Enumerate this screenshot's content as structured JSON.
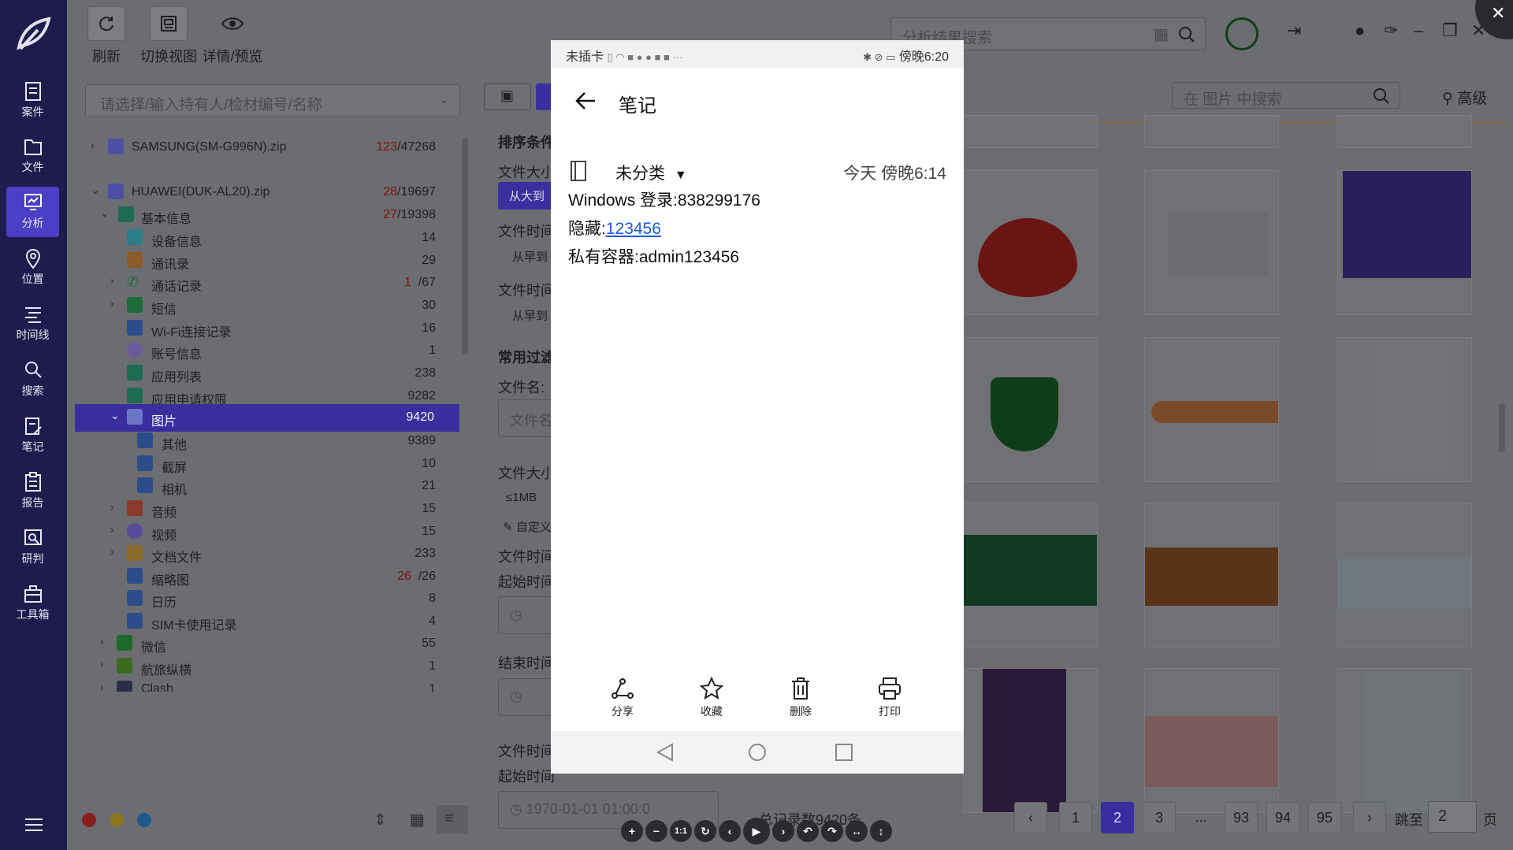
{
  "nav": {
    "items": [
      {
        "label": "案件",
        "icon": "case-icon"
      },
      {
        "label": "文件",
        "icon": "folder-icon"
      },
      {
        "label": "分析",
        "icon": "analysis-icon"
      },
      {
        "label": "位置",
        "icon": "location-icon"
      },
      {
        "label": "时间线",
        "icon": "timeline-icon"
      },
      {
        "label": "搜索",
        "icon": "search-icon"
      },
      {
        "label": "笔记",
        "icon": "note-icon"
      },
      {
        "label": "报告",
        "icon": "report-icon"
      },
      {
        "label": "研判",
        "icon": "judge-icon"
      },
      {
        "label": "工具箱",
        "icon": "toolbox-icon"
      }
    ],
    "active": "分析"
  },
  "toolbar": {
    "refresh": "刷新",
    "switch_view": "切换视图",
    "details": "详情/预览"
  },
  "left_panel": {
    "selector_placeholder": "请选择/输入持有人/检材编号/名称",
    "tree": [
      {
        "label": "SAMSUNG(SM-G996N).zip",
        "red": "123",
        "count": "/47268"
      },
      {
        "label": "HUAWEI(DUK-AL20).zip",
        "red": "28",
        "count": "/19697"
      },
      {
        "label": "基本信息",
        "red": "27",
        "count": "/19398"
      },
      {
        "label": "设备信息",
        "red": "",
        "count": "14"
      },
      {
        "label": "通讯录",
        "red": "",
        "count": "29"
      },
      {
        "label": "通话记录",
        "red": "1",
        "count": "/67"
      },
      {
        "label": "短信",
        "red": "",
        "count": "30"
      },
      {
        "label": "Wi-Fi连接记录",
        "red": "",
        "count": "16"
      },
      {
        "label": "账号信息",
        "red": "",
        "count": "1"
      },
      {
        "label": "应用列表",
        "red": "",
        "count": "238"
      },
      {
        "label": "应用申请权限",
        "red": "",
        "count": "9282"
      },
      {
        "label": "图片",
        "red": "",
        "count": "9420"
      },
      {
        "label": "其他",
        "red": "",
        "count": "9389"
      },
      {
        "label": "截屏",
        "red": "",
        "count": "10"
      },
      {
        "label": "相机",
        "red": "",
        "count": "21"
      },
      {
        "label": "音频",
        "red": "",
        "count": "15"
      },
      {
        "label": "视频",
        "red": "",
        "count": "15"
      },
      {
        "label": "文档文件",
        "red": "",
        "count": "233"
      },
      {
        "label": "缩略图",
        "red": "26",
        "count": "/26"
      },
      {
        "label": "日历",
        "red": "",
        "count": "8"
      },
      {
        "label": "SIM卡使用记录",
        "red": "",
        "count": "4"
      },
      {
        "label": "微信",
        "red": "",
        "count": "55"
      },
      {
        "label": "航旅纵横",
        "red": "",
        "count": "1"
      },
      {
        "label": "Clash",
        "red": "",
        "count": "1"
      }
    ]
  },
  "filter": {
    "sort_title": "排序条件",
    "file_size": "文件大小",
    "size_btn": "从大到",
    "file_time1": "文件时间",
    "from_early1": "从早到",
    "file_time2": "文件时间",
    "from_early2": "从早到",
    "common_filter": "常用过滤",
    "file_name": "文件名:",
    "file_name_ph": "文件名",
    "file_size2": "文件大小",
    "le1mb": "≤1MB",
    "custom": "自定义",
    "file_time3": "文件时间",
    "start_time": "起始时间",
    "end_time": "结束时间",
    "file_time4": "文件时间",
    "start_time2": "起始时间",
    "date_value": "1970-01-01 01:00:0"
  },
  "top": {
    "search_placeholder": "分析结果搜索",
    "img_search_placeholder": "在 图片 中搜索",
    "advanced": "高级"
  },
  "pagination": {
    "total": "总记录数9420条",
    "pages": [
      "1",
      "2",
      "3",
      "...",
      "93",
      "94",
      "95"
    ],
    "current": "2",
    "jump_label": "跳至",
    "jump_value": "2",
    "page_label": "页"
  },
  "phone": {
    "status_left": "未插卡",
    "status_right": "傍晚6:20",
    "title": "笔记",
    "category": "未分类",
    "date": "今天 傍晚6:14",
    "lines": {
      "line1": "Windows 登录:838299176",
      "line2_prefix": "隐藏:",
      "line2_link": "123456",
      "line3": "私有容器:admin123456"
    },
    "actions": [
      "分享",
      "收藏",
      "删除",
      "打印"
    ]
  },
  "colors": {
    "nav_bg": "#1f1b4d",
    "accent": "#4b3fc6",
    "link": "#1a59e0"
  }
}
